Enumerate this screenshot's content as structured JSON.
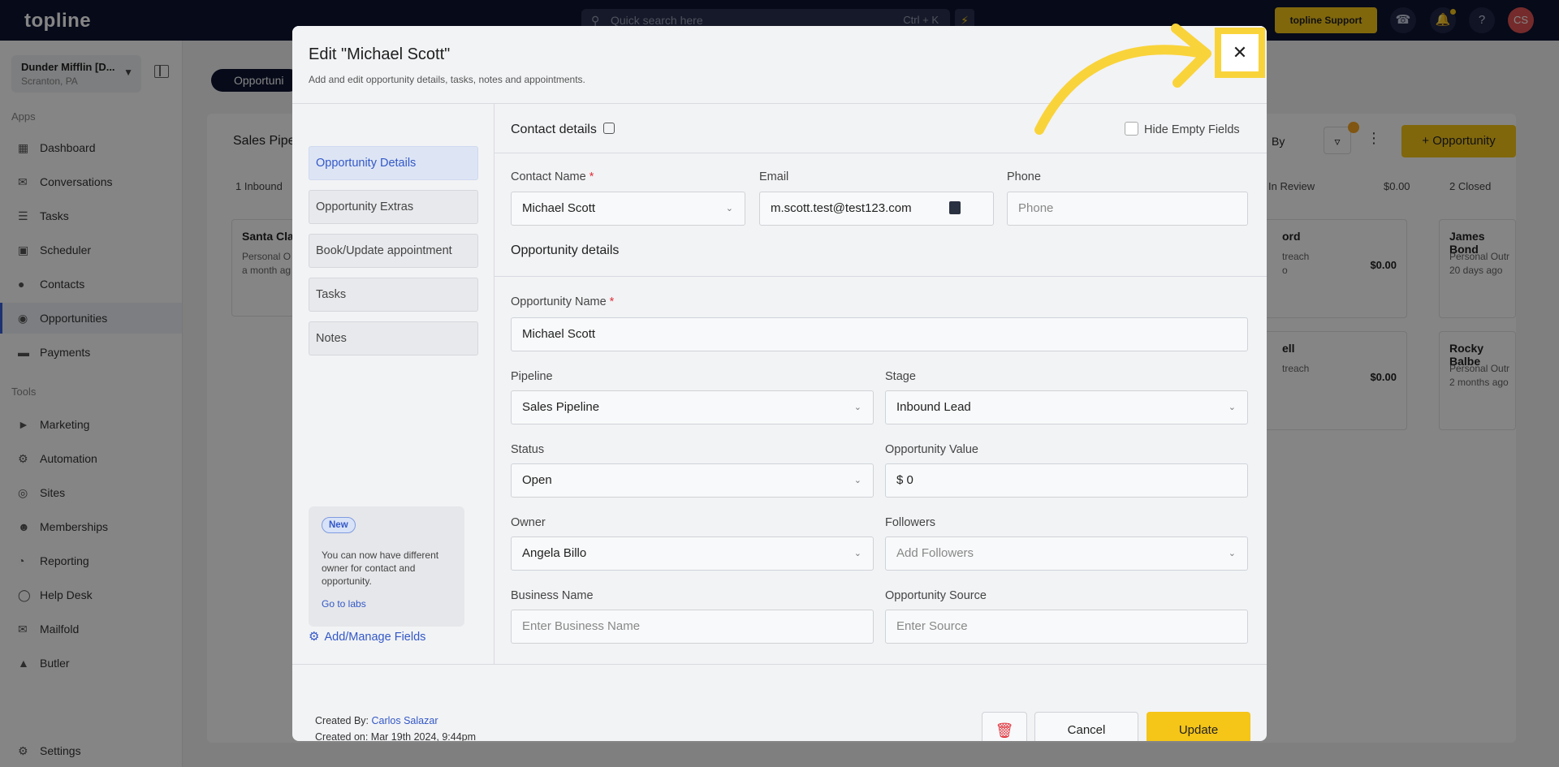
{
  "topbar": {
    "logo": "topline",
    "search_placeholder": "Quick search here",
    "search_shortcut": "Ctrl + K",
    "support_label": "topline Support",
    "avatar_initials": "CS"
  },
  "sidebar": {
    "location_name": "Dunder Mifflin [D...",
    "location_sub": "Scranton, PA",
    "apps_heading": "Apps",
    "tools_heading": "Tools",
    "apps": [
      {
        "label": "Dashboard"
      },
      {
        "label": "Conversations"
      },
      {
        "label": "Tasks"
      },
      {
        "label": "Scheduler"
      },
      {
        "label": "Contacts"
      },
      {
        "label": "Opportunities"
      },
      {
        "label": "Payments"
      }
    ],
    "tools": [
      {
        "label": "Marketing"
      },
      {
        "label": "Automation"
      },
      {
        "label": "Sites"
      },
      {
        "label": "Memberships"
      },
      {
        "label": "Reporting"
      },
      {
        "label": "Help Desk"
      },
      {
        "label": "Mailfold"
      },
      {
        "label": "Butler"
      }
    ],
    "settings_label": "Settings"
  },
  "background": {
    "pill_label": "Opportuni",
    "board_title": "Sales Pipe",
    "sort_label": "By",
    "add_opportunity_label": "Opportunity",
    "col1_head": "1   Inbound",
    "col_review_head": "In Review",
    "col_review_total": "$0.00",
    "col_closed_head": "2   Closed",
    "cards": [
      {
        "name": "Santa Cla",
        "sub1": "Personal O",
        "sub2": "a month ag"
      },
      {
        "name": "ord",
        "sub1": "treach",
        "sub2": "o",
        "value": "$0.00"
      },
      {
        "name": "ell",
        "sub1": "treach",
        "value": "$0.00"
      },
      {
        "name": "James Bond",
        "sub1": "Personal Outr",
        "sub2": "20 days ago"
      },
      {
        "name": "Rocky Balbe",
        "sub1": "Personal Outr",
        "sub2": "2 months ago"
      }
    ]
  },
  "modal": {
    "title": "Edit \"Michael Scott\"",
    "subtitle": "Add and edit opportunity details, tasks, notes and appointments.",
    "nav": [
      {
        "label": "Opportunity Details"
      },
      {
        "label": "Opportunity Extras"
      },
      {
        "label": "Book/Update appointment"
      },
      {
        "label": "Tasks"
      },
      {
        "label": "Notes"
      }
    ],
    "promo": {
      "badge": "New",
      "text": "You can now have different owner for contact and opportunity.",
      "link": "Go to labs"
    },
    "manage_fields": "Add/Manage Fields",
    "contact_section": "Contact details",
    "hide_empty_label": "Hide Empty Fields",
    "contact_name_label": "Contact Name",
    "contact_name_value": "Michael Scott",
    "email_label": "Email",
    "email_value": "m.scott.test@test123.com",
    "phone_label": "Phone",
    "phone_placeholder": "Phone",
    "opp_section": "Opportunity details",
    "opp_name_label": "Opportunity Name",
    "opp_name_value": "Michael Scott",
    "pipeline_label": "Pipeline",
    "pipeline_value": "Sales Pipeline",
    "stage_label": "Stage",
    "stage_value": "Inbound Lead",
    "status_label": "Status",
    "status_value": "Open",
    "value_label": "Opportunity Value",
    "value_value": "$ 0",
    "owner_label": "Owner",
    "owner_value": "Angela Billo",
    "followers_label": "Followers",
    "followers_placeholder": "Add Followers",
    "business_label": "Business Name",
    "business_placeholder": "Enter Business Name",
    "source_label": "Opportunity Source",
    "source_placeholder": "Enter Source",
    "created_by_label": "Created By:",
    "created_by_value": "Carlos Salazar",
    "created_on": "Created on: Mar 19th 2024, 9:44pm",
    "cancel_label": "Cancel",
    "update_label": "Update"
  },
  "colors": {
    "accent_yellow": "#f5c518",
    "highlight_yellow": "#f9d33a",
    "link_blue": "#3358c7",
    "topbar_navy": "#0d1530"
  }
}
